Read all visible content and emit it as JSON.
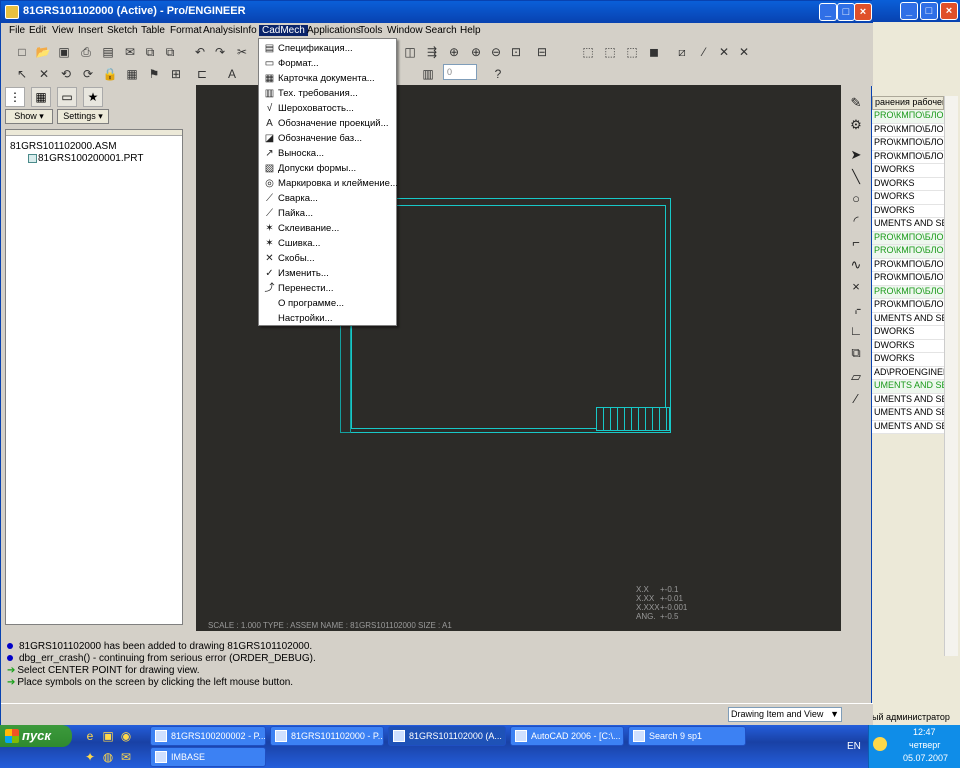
{
  "colors": {
    "canvas": "#2c2b28",
    "sheet_border": "#18c8c8",
    "titlebar": "#0a5fd8",
    "menu_highlight": "#0a246a"
  },
  "window": {
    "title": "81GRS101102000 (Active) - Pro/ENGINEER",
    "icon": "proe-icon",
    "buttons": [
      "minimize-icon",
      "maximize-icon",
      "close-icon"
    ]
  },
  "menus": [
    "File",
    "Edit",
    "View",
    "Insert",
    "Sketch",
    "Table",
    "Format",
    "Analysis",
    "Info",
    "CadMech",
    "Applications",
    "Tools",
    "Window",
    "Search",
    "Help"
  ],
  "active_menu": "CadMech",
  "cadmech_menu": [
    {
      "label": "Спецификация...",
      "icon": "spec-icon"
    },
    {
      "label": "Формат...",
      "icon": "format-icon"
    },
    {
      "label": "Карточка документа...",
      "icon": "card-icon"
    },
    {
      "label": "Тех. требования...",
      "icon": "tech-req-icon"
    },
    {
      "label": "Шероховатость...",
      "icon": "roughness-icon"
    },
    {
      "label": "Обозначение проекций...",
      "icon": "projection-icon"
    },
    {
      "label": "Обозначение баз...",
      "icon": "datum-icon"
    },
    {
      "label": "Выноска...",
      "icon": "leader-icon"
    },
    {
      "label": "Допуски формы...",
      "icon": "tolerance-icon"
    },
    {
      "label": "Маркировка и клеймение...",
      "icon": "marking-icon"
    },
    {
      "label": "Сварка...",
      "icon": "weld-icon"
    },
    {
      "label": "Пайка...",
      "icon": "solder-icon"
    },
    {
      "label": "Склеивание...",
      "icon": "glue-icon"
    },
    {
      "label": "Сшивка...",
      "icon": "stitch-icon"
    },
    {
      "label": "Скобы...",
      "icon": "staple-icon"
    },
    {
      "label": "Изменить...",
      "icon": "edit-icon"
    },
    {
      "label": "Перенести...",
      "icon": "move-icon"
    },
    {
      "label": "О программе...",
      "icon": ""
    },
    {
      "label": "Настройки...",
      "icon": ""
    }
  ],
  "left_panel": {
    "show_label": "Show ▾",
    "settings_label": "Settings ▾",
    "tree": [
      {
        "label": "81GRS101102000.ASM",
        "level": 0
      },
      {
        "label": "81GRS100200001.PRT",
        "level": 1
      }
    ]
  },
  "drawing": {
    "scale_line": "SCALE : 1.000    TYPE : ASSEM    NAME : 81GRS101102000    SIZE : A1",
    "tolerances": [
      {
        "label": "X.X",
        "value": "+-0.1"
      },
      {
        "label": "X.XX",
        "value": "+-0.01"
      },
      {
        "label": "X.XXX",
        "value": "+-0.001"
      },
      {
        "label": "ANG.",
        "value": "+-0.5"
      }
    ]
  },
  "messages": [
    {
      "type": "info",
      "text": "81GRS101102000 has been added to drawing 81GRS101102000."
    },
    {
      "type": "info",
      "text": "dbg_err_crash() - continuing from serious error (ORDER_DEBUG)."
    },
    {
      "type": "prompt",
      "text": "Select CENTER POINT for drawing view."
    },
    {
      "type": "prompt",
      "text": "Place symbols on the screen by clicking the left mouse button."
    }
  ],
  "selection_filter": "Drawing Item and View",
  "background_window": {
    "header": "ранения рабочей",
    "rows": [
      {
        "text": "PRO\\КМПО\\БЛОК",
        "green": true
      },
      {
        "text": "PRO\\КМПО\\БЛОК",
        "green": false
      },
      {
        "text": "PRO\\КМПО\\БЛОК",
        "green": false
      },
      {
        "text": "PRO\\КМПО\\БЛОК",
        "green": false
      },
      {
        "text": "DWORKS",
        "green": false
      },
      {
        "text": "DWORKS",
        "green": false
      },
      {
        "text": "DWORKS",
        "green": false
      },
      {
        "text": "DWORKS",
        "green": false
      },
      {
        "text": "UMENTS AND SETT",
        "green": false
      },
      {
        "text": "PRO\\КМПО\\БЛОК",
        "green": true
      },
      {
        "text": "PRO\\КМПО\\БЛОК",
        "green": true
      },
      {
        "text": "PRO\\КМПО\\БЛОК",
        "green": false
      },
      {
        "text": "PRO\\КМПО\\БЛОК",
        "green": false
      },
      {
        "text": "PRO\\КМПО\\БЛОК",
        "green": true
      },
      {
        "text": "PRO\\КМПО\\БЛОК",
        "green": false
      },
      {
        "text": "UMENTS AND SETT",
        "green": false
      },
      {
        "text": "DWORKS",
        "green": false
      },
      {
        "text": "DWORKS",
        "green": false
      },
      {
        "text": "DWORKS",
        "green": false
      },
      {
        "text": "AD\\PROENGINEER\\",
        "green": false
      },
      {
        "text": "UMENTS AND SETT",
        "green": true
      },
      {
        "text": "UMENTS AND SETT",
        "green": false
      },
      {
        "text": "UMENTS AND SETT",
        "green": false
      },
      {
        "text": "UMENTS AND SETT",
        "green": false
      }
    ],
    "admin": "ый администратор"
  },
  "taskbar": {
    "start": "пуск",
    "tasks_row1": [
      {
        "label": "81GRS100200002 - P...",
        "active": false
      },
      {
        "label": "81GRS101102000 - P...",
        "active": false
      },
      {
        "label": "81GRS101102000 (A...",
        "active": true
      },
      {
        "label": "AutoCAD 2006 - [C:\\...",
        "active": false
      },
      {
        "label": "Search 9 sp1",
        "active": false
      }
    ],
    "tasks_row2": [
      {
        "label": "IMBASE",
        "active": false
      }
    ],
    "lang": "EN",
    "time": "12:47",
    "day": "четверг",
    "date": "05.07.2007"
  }
}
